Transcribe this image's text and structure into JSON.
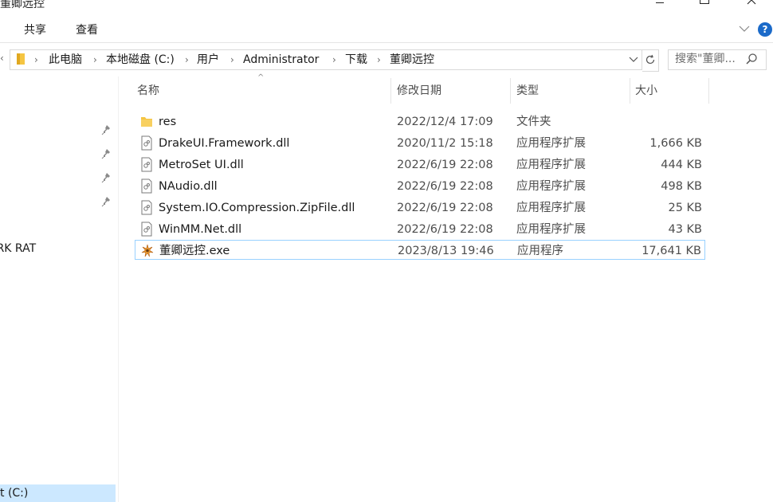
{
  "window": {
    "title": "董卿远控"
  },
  "ribbon": {
    "tabs": [
      {
        "label": "共享"
      },
      {
        "label": "查看"
      }
    ],
    "help": "?"
  },
  "address": {
    "crumbs": [
      "此电脑",
      "本地磁盘 (C:)",
      "用户",
      "Administrator",
      "下载",
      "董卿远控"
    ]
  },
  "search": {
    "placeholder": "搜索\"董卿..."
  },
  "nav": {
    "items": [
      {
        "label": "ARK RAT"
      },
      {
        "label": "t (C:)"
      }
    ]
  },
  "columns": {
    "name": "名称",
    "date": "修改日期",
    "type": "类型",
    "size": "大小"
  },
  "files": [
    {
      "name": "res",
      "date": "2022/12/4 17:09",
      "type": "文件夹",
      "size": "",
      "icon": "folder-icon"
    },
    {
      "name": "DrakeUI.Framework.dll",
      "date": "2020/11/2 15:18",
      "type": "应用程序扩展",
      "size": "1,666 KB",
      "icon": "dll-file-icon"
    },
    {
      "name": "MetroSet UI.dll",
      "date": "2022/6/19 22:08",
      "type": "应用程序扩展",
      "size": "444 KB",
      "icon": "dll-file-icon"
    },
    {
      "name": "NAudio.dll",
      "date": "2022/6/19 22:08",
      "type": "应用程序扩展",
      "size": "498 KB",
      "icon": "dll-file-icon"
    },
    {
      "name": "System.IO.Compression.ZipFile.dll",
      "date": "2022/6/19 22:08",
      "type": "应用程序扩展",
      "size": "25 KB",
      "icon": "dll-file-icon"
    },
    {
      "name": "WinMM.Net.dll",
      "date": "2022/6/19 22:08",
      "type": "应用程序扩展",
      "size": "43 KB",
      "icon": "dll-file-icon"
    },
    {
      "name": "董卿远控.exe",
      "date": "2023/8/13 19:46",
      "type": "应用程序",
      "size": "17,641 KB",
      "icon": "exe-app-icon"
    }
  ],
  "colors": {
    "selection_border": "#99d1ff",
    "nav_selected": "#cce8ff",
    "help_blue": "#1b6ac9",
    "folder_yellow": "#f5c542"
  }
}
